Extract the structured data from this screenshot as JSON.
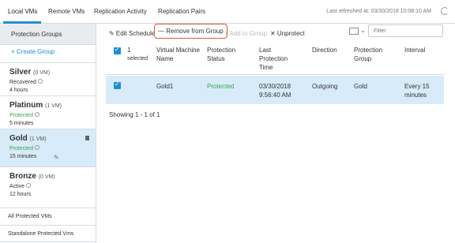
{
  "tabs": [
    {
      "label": "Local VMs",
      "active": true
    },
    {
      "label": "Remote VMs",
      "active": false
    },
    {
      "label": "Replication Activity",
      "active": false
    },
    {
      "label": "Replication Pairs",
      "active": false
    }
  ],
  "last_refreshed": "Last refreshed at: 03/30/2018 10:08:10 AM",
  "sidebar": {
    "header": "Protection Groups",
    "create_group": "+ Create Group",
    "groups": [
      {
        "name": "Silver",
        "vm_count": "(0 VM)",
        "status": "Recovered",
        "interval": "4 hours"
      },
      {
        "name": "Platinum",
        "vm_count": "(1 VM)",
        "status": "Protected",
        "interval": "5 minutes"
      },
      {
        "name": "Gold",
        "vm_count": "(1 VM)",
        "status": "Protected",
        "interval": "15 minutes"
      },
      {
        "name": "Bronze",
        "vm_count": "(0 VM)",
        "status": "Active",
        "interval": "12 hours"
      }
    ],
    "all_protected": "All Protected VMs",
    "standalone_protected": "Standalone Protected Vms"
  },
  "toolbar": {
    "edit_schedule": "✎ Edit Schedule",
    "remove_from_group": "— Remove from Group",
    "add_to_group": "+ Add to Group",
    "unprotect": "✕ Unprotect",
    "filter_placeholder": "Filter"
  },
  "table": {
    "selected_count": "1",
    "selected_label": "selected",
    "columns": [
      "Virtual Machine Name",
      "Protection Status",
      "Last Protection Time",
      "Direction",
      "Protection Group",
      "Interval"
    ],
    "rows": [
      {
        "vm_name": "Gold1",
        "status": "Protected",
        "last_time": "03/30/2018 9:56:40 AM",
        "direction": "Outgoing",
        "group": "Gold",
        "interval": "Every 15 minutes"
      }
    ],
    "showing": "Showing 1 - 1 of 1"
  },
  "colors": {
    "accent": "#1f8fd4",
    "protected": "#3aa54c",
    "selected_row": "#d8ebf8",
    "highlight_border": "#e3573f"
  }
}
